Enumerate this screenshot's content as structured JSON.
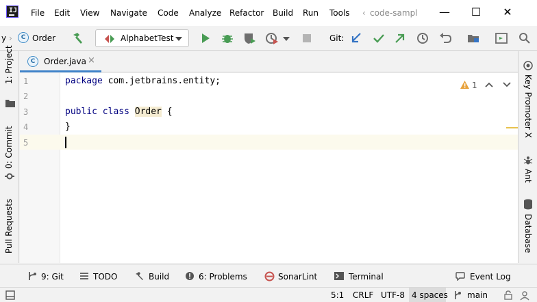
{
  "menu": {
    "items": [
      "File",
      "Edit",
      "View",
      "Navigate",
      "Code",
      "Analyze",
      "Refactor",
      "Build",
      "Run",
      "Tools"
    ],
    "project_title": "code-sampl"
  },
  "window_controls": {
    "minimize": "—",
    "maximize": "☐",
    "close": "✕"
  },
  "breadcrumb": {
    "prev": "y",
    "separator": "›",
    "current": "Order",
    "class_icon_letter": "C"
  },
  "run_config": {
    "label": "AlphabetTest"
  },
  "git": {
    "label": "Git:"
  },
  "left_tools": {
    "project": "1: Project",
    "commit": "0: Commit",
    "pull_requests": "Pull Requests"
  },
  "right_tools": {
    "key_promoter": "Key Promoter X",
    "ant": "Ant",
    "database": "Database"
  },
  "tabs": [
    {
      "label": "Order.java",
      "icon_letter": "C",
      "close": "×"
    }
  ],
  "editor": {
    "line_numbers": [
      "1",
      "2",
      "3",
      "4",
      "5"
    ],
    "line1_kw": "package",
    "line1_rest": " com.jetbrains.entity;",
    "line3_kw": "public class",
    "line3_sp": " ",
    "line3_class": "Order",
    "line3_brace": " {",
    "line4": "}",
    "warnings_count": "1"
  },
  "bottom_tools": {
    "git": "9: Git",
    "todo": "TODO",
    "build": "Build",
    "problems": "6: Problems",
    "sonarlint": "SonarLint",
    "terminal": "Terminal",
    "event_log": "Event Log"
  },
  "status": {
    "position": "5:1",
    "line_sep": "CRLF",
    "encoding": "UTF-8",
    "indent": "4 spaces",
    "branch": "main"
  },
  "colors": {
    "accent": "#4083c9",
    "keyword": "#000080",
    "run_green": "#499c54",
    "git_blue": "#3574c4",
    "warning": "#e8a33d"
  }
}
